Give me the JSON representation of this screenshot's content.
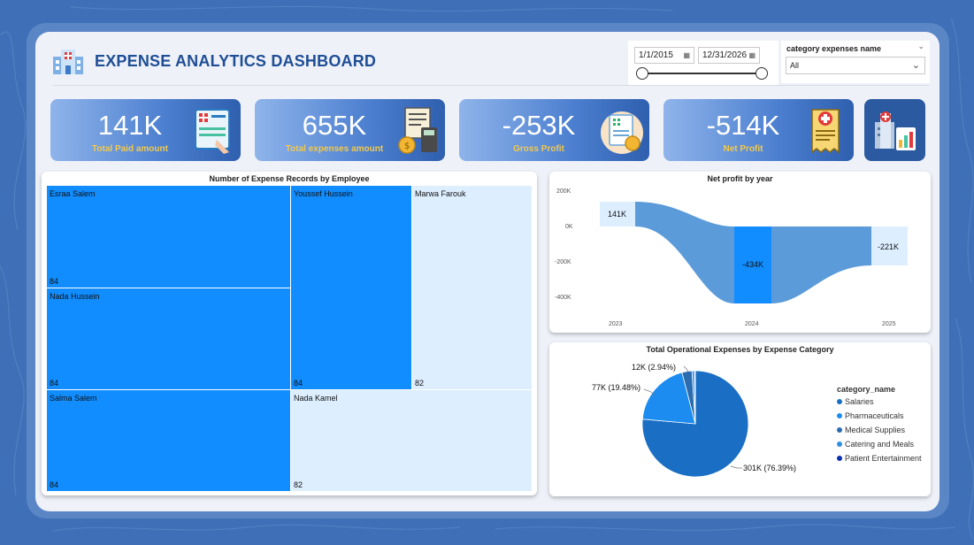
{
  "header": {
    "title": "EXPENSE ANALYTICS DASHBOARD"
  },
  "filters": {
    "date_start": "1/1/2015",
    "date_end": "12/31/2026",
    "category_label": "category expenses name",
    "category_value": "All"
  },
  "kpis": [
    {
      "value": "141K",
      "label": "Total Paid amount",
      "icon": "invoice-icon"
    },
    {
      "value": "655K",
      "label": "Total expenses amount",
      "icon": "calculator-icon"
    },
    {
      "value": "-253K",
      "label": "Gross Profit",
      "icon": "medical-bill-icon"
    },
    {
      "value": "-514K",
      "label": "Net  Profit",
      "icon": "receipt-icon"
    }
  ],
  "treemap": {
    "title": "Number of Expense Records by Employee",
    "cells": [
      {
        "name": "Esraa Salem",
        "value": "84"
      },
      {
        "name": "Nada Hussein",
        "value": "84"
      },
      {
        "name": "Salma Salem",
        "value": "84"
      },
      {
        "name": "Youssef Hussein",
        "value": "84"
      },
      {
        "name": "Marwa Farouk",
        "value": "82"
      },
      {
        "name": "Nada Kamel",
        "value": "82"
      }
    ]
  },
  "net_profit": {
    "title": "Net profit by year",
    "y_ticks": [
      "200K",
      "0K",
      "-200K",
      "-400K"
    ],
    "x_ticks": [
      "2023",
      "2024",
      "2025"
    ],
    "data_labels": [
      "141K",
      "-434K",
      "-221K"
    ]
  },
  "pie": {
    "title": "Total Operational Expenses by Expense Category",
    "labels": [
      "301K (76.39%)",
      "77K (19.48%)",
      "12K (2.94%)"
    ],
    "legend_title": "category_name",
    "legend": [
      {
        "name": "Salaries",
        "color": "#1a6fc4"
      },
      {
        "name": "Pharmaceuticals",
        "color": "#1c8cf0"
      },
      {
        "name": "Medical Supplies",
        "color": "#2b6cb0"
      },
      {
        "name": "Catering and Meals",
        "color": "#2e8fe0"
      },
      {
        "name": "Patient Entertainment",
        "color": "#0b2fb0"
      }
    ]
  },
  "chart_data": [
    {
      "type": "treemap",
      "title": "Number of Expense Records by Employee",
      "categories": [
        "Esraa Salem",
        "Nada Hussein",
        "Salma Salem",
        "Youssef Hussein",
        "Marwa Farouk",
        "Nada Kamel"
      ],
      "values": [
        84,
        84,
        84,
        84,
        82,
        82
      ]
    },
    {
      "type": "area",
      "title": "Net profit by year",
      "categories": [
        "2023",
        "2024",
        "2025"
      ],
      "values": [
        141,
        -434,
        -221
      ],
      "ylim": [
        -400,
        200
      ]
    },
    {
      "type": "pie",
      "title": "Total Operational Expenses by Expense Category",
      "categories": [
        "Salaries",
        "Pharmaceuticals",
        "Medical Supplies",
        "Catering and Meals",
        "Patient Entertainment"
      ],
      "values": [
        301,
        77,
        12,
        3,
        1
      ]
    }
  ]
}
